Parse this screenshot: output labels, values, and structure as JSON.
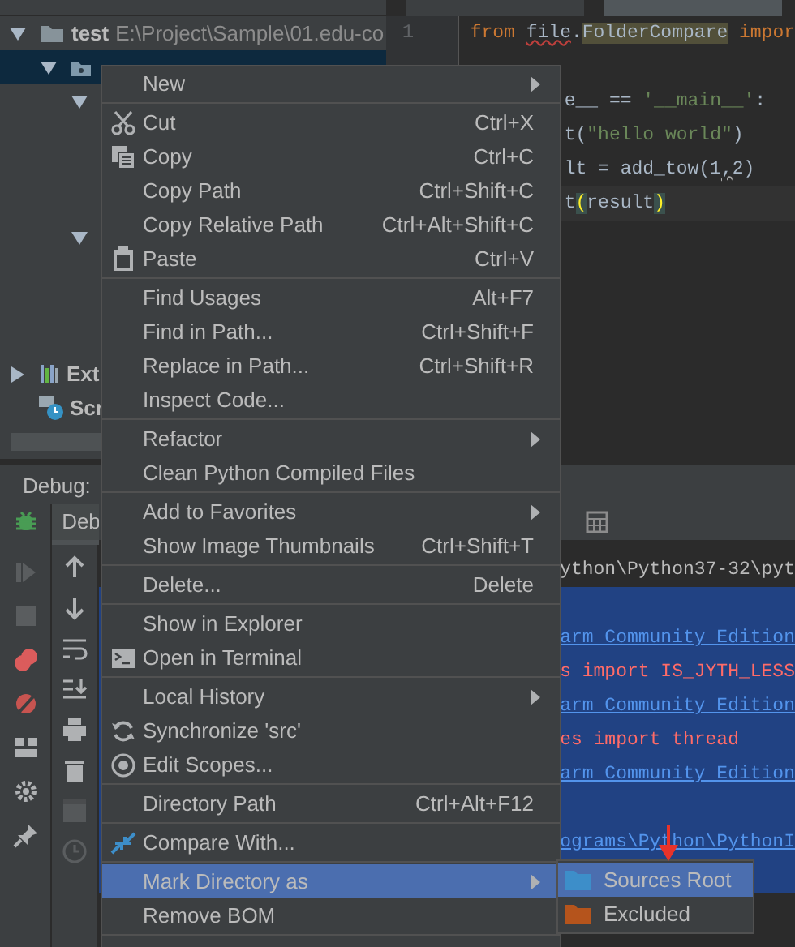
{
  "editor_tabs": [
    {
      "selected": false
    },
    {
      "selected": true
    }
  ],
  "project_tree": [
    {
      "kind": "folder",
      "label": "test",
      "path": "E:\\Project\\Sample\\01.edu-co",
      "expanded": true,
      "selected": false,
      "children": [
        {
          "kind": "folder",
          "selected": true,
          "expanded": true,
          "children": [
            {
              "selected": false,
              "expanded": true
            },
            {
              "selected": false,
              "expanded": true
            }
          ]
        }
      ]
    },
    {
      "kind": "libraries",
      "label": "Ext",
      "expanded": false,
      "selected": false
    },
    {
      "kind": "scratches",
      "label": "Scr",
      "selected": false
    }
  ],
  "editor": {
    "line_numbers": [
      "1"
    ],
    "lines": [
      {
        "kind": "full",
        "tokens": [
          {
            "text": "from ",
            "kind": "keyword"
          },
          {
            "text": "file",
            "kind": "error"
          },
          {
            "text": ".",
            "kind": "plain"
          },
          {
            "text": "FolderCompare",
            "kind": "match"
          },
          {
            "text": "impor",
            "kind": "keyword"
          }
        ]
      },
      {
        "kind": "full"
      },
      {
        "kind": "covered",
        "tokens": [
          {
            "text": "e__ == ",
            "kind": "plain"
          },
          {
            "text": "'__main__'",
            "kind": "string"
          },
          {
            "text": ":",
            "kind": "plain"
          }
        ]
      },
      {
        "kind": "covered",
        "tokens": [
          {
            "text": "t(",
            "kind": "plain"
          },
          {
            "text": "\"hello world\"",
            "kind": "string"
          },
          {
            "text": ")",
            "kind": "plain"
          }
        ]
      },
      {
        "kind": "covered",
        "tokens": [
          {
            "text": "lt = add_tow(1",
            "kind": "plain"
          },
          {
            "text": ",",
            "kind": "warning"
          },
          {
            "text": "2)",
            "kind": "plain"
          }
        ]
      },
      {
        "kind": "covered",
        "current": true,
        "tokens": [
          {
            "text": "t",
            "kind": "plain"
          },
          {
            "text": "(",
            "kind": "brace"
          },
          {
            "text": "result",
            "kind": "plain"
          },
          {
            "text": ")",
            "kind": "brace"
          }
        ]
      }
    ]
  },
  "debug": {
    "title": "Debug:",
    "tabs": [
      {
        "label": "Deb",
        "selected": true
      }
    ],
    "console": [
      {
        "text": "ython\\Python37-32\\pyt",
        "kind": "plain",
        "selected": false
      },
      {
        "selected": true
      },
      {
        "text": "arm Community Edition",
        "kind": "link",
        "selected": true
      },
      {
        "text": "s import IS_JYTH_LESS",
        "kind": "error",
        "selected": true
      },
      {
        "text": "arm Community Edition",
        "kind": "link",
        "selected": true
      },
      {
        "text": "es import thread",
        "kind": "error",
        "selected": true
      },
      {
        "text": "arm Community Edition",
        "kind": "link",
        "selected": true
      },
      {
        "selected": true
      },
      {
        "text": "ograms\\Python\\PythonI",
        "kind": "link",
        "selected": true
      },
      {
        "selected": true
      }
    ]
  },
  "context_menu": {
    "items": [
      {
        "kind": "item",
        "label": "New",
        "submenu": true,
        "selected": false
      },
      {
        "kind": "separator"
      },
      {
        "kind": "item",
        "label": "Cut",
        "shortcut": "Ctrl+X",
        "selected": false
      },
      {
        "kind": "item",
        "label": "Copy",
        "shortcut": "Ctrl+C",
        "selected": false
      },
      {
        "kind": "item",
        "label": "Copy Path",
        "shortcut": "Ctrl+Shift+C",
        "selected": false
      },
      {
        "kind": "item",
        "label": "Copy Relative Path",
        "shortcut": "Ctrl+Alt+Shift+C",
        "selected": false
      },
      {
        "kind": "item",
        "label": "Paste",
        "shortcut": "Ctrl+V",
        "selected": false
      },
      {
        "kind": "separator"
      },
      {
        "kind": "item",
        "label": "Find Usages",
        "shortcut": "Alt+F7",
        "selected": false
      },
      {
        "kind": "item",
        "label": "Find in Path...",
        "shortcut": "Ctrl+Shift+F",
        "selected": false
      },
      {
        "kind": "item",
        "label": "Replace in Path...",
        "shortcut": "Ctrl+Shift+R",
        "selected": false
      },
      {
        "kind": "item",
        "label": "Inspect Code...",
        "selected": false
      },
      {
        "kind": "separator"
      },
      {
        "kind": "item",
        "label": "Refactor",
        "submenu": true,
        "selected": false
      },
      {
        "kind": "item",
        "label": "Clean Python Compiled Files",
        "selected": false
      },
      {
        "kind": "separator"
      },
      {
        "kind": "item",
        "label": "Add to Favorites",
        "submenu": true,
        "selected": false
      },
      {
        "kind": "item",
        "label": "Show Image Thumbnails",
        "shortcut": "Ctrl+Shift+T",
        "selected": false
      },
      {
        "kind": "separator"
      },
      {
        "kind": "item",
        "label": "Delete...",
        "shortcut": "Delete",
        "selected": false
      },
      {
        "kind": "separator"
      },
      {
        "kind": "item",
        "label": "Show in Explorer",
        "selected": false
      },
      {
        "kind": "item",
        "label": "Open in Terminal",
        "selected": false
      },
      {
        "kind": "separator"
      },
      {
        "kind": "item",
        "label": "Local History",
        "submenu": true,
        "selected": false
      },
      {
        "kind": "item",
        "label": "Synchronize 'src'",
        "selected": false
      },
      {
        "kind": "item",
        "label": "Edit Scopes...",
        "selected": false
      },
      {
        "kind": "separator"
      },
      {
        "kind": "item",
        "label": "Directory Path",
        "shortcut": "Ctrl+Alt+F12",
        "selected": false
      },
      {
        "kind": "separator"
      },
      {
        "kind": "item",
        "label": "Compare With...",
        "selected": false
      },
      {
        "kind": "separator"
      },
      {
        "kind": "item",
        "label": "Mark Directory as",
        "submenu": true,
        "selected": true
      },
      {
        "kind": "item",
        "label": "Remove BOM",
        "selected": false
      },
      {
        "kind": "separator"
      }
    ]
  },
  "submenu": {
    "items": [
      {
        "label": "Sources Root",
        "color": "#3d8ec9",
        "selected": true
      },
      {
        "label": "Excluded",
        "color": "#b5541c",
        "selected": false
      }
    ]
  }
}
